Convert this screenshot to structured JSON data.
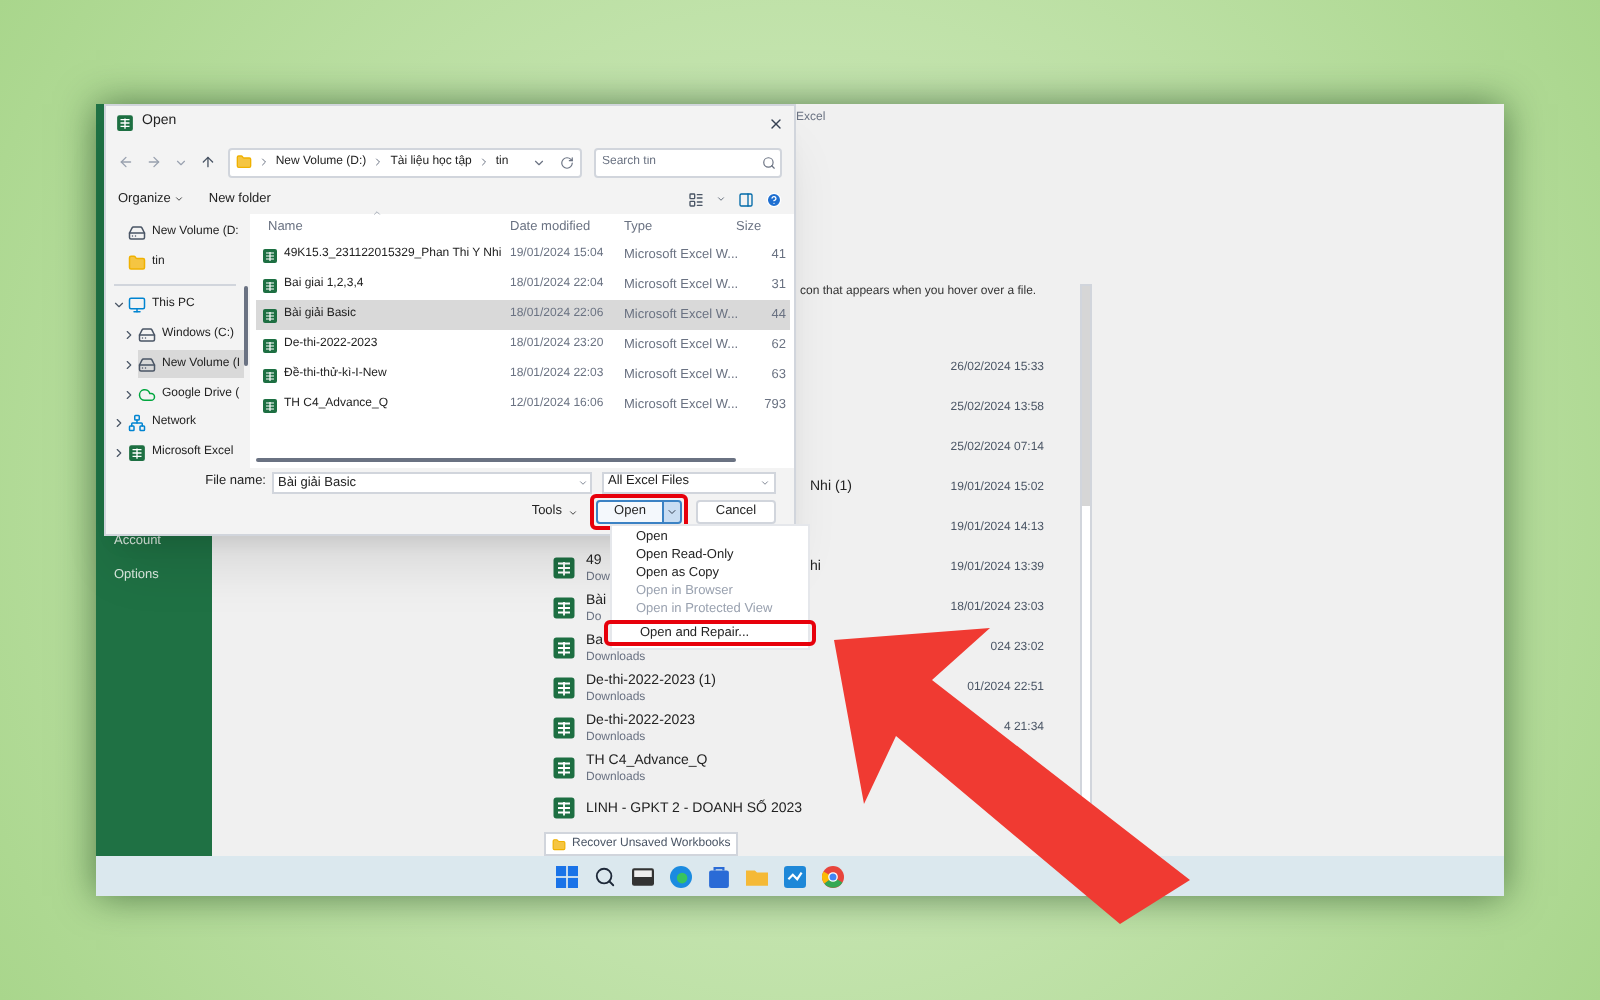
{
  "excel": {
    "title": "Excel",
    "sidebar": [
      "Account",
      "Options"
    ],
    "hint": "con that appears when you hover over a file.",
    "recent": [
      {
        "kind": "covered",
        "date": "26/02/2024 15:33"
      },
      {
        "kind": "covered",
        "date": "25/02/2024 13:58"
      },
      {
        "kind": "covered",
        "date": "25/02/2024 07:14"
      },
      {
        "kind": "covered",
        "tail": "Nhi (1)",
        "date": "19/01/2024 15:02"
      },
      {
        "kind": "covered",
        "date": "19/01/2024 14:13"
      },
      {
        "kind": "file",
        "name": "49",
        "location": "Dow",
        "tail": "hi",
        "date": "19/01/2024 13:39"
      },
      {
        "kind": "file",
        "name": "Bài",
        "location": "Do",
        "date": "18/01/2024 23:03"
      },
      {
        "kind": "file",
        "name": "Ba",
        "location": "Downloads",
        "date": "024 23:02"
      },
      {
        "kind": "file",
        "name": "De-thi-2022-2023 (1)",
        "location": "Downloads",
        "date": "01/2024 22:51"
      },
      {
        "kind": "file",
        "name": "De-thi-2022-2023",
        "location": "Downloads",
        "date": "4 21:34"
      },
      {
        "kind": "file",
        "name": "TH C4_Advance_Q",
        "location": "Downloads"
      },
      {
        "kind": "file",
        "name": "LINH - GPKT 2 - DOANH SỐ 2023"
      }
    ],
    "recover_button": "Recover Unsaved Workbooks"
  },
  "dialog": {
    "title": "Open",
    "path": [
      "New Volume (D:)",
      "Tài liệu học tập",
      "tin"
    ],
    "search": {
      "placeholder": "Search tin"
    },
    "toolbar": {
      "organize": "Organize",
      "new_folder": "New folder"
    },
    "nav": [
      {
        "label": "New Volume (D:",
        "kind": "drive",
        "selected": false
      },
      {
        "label": "tin",
        "kind": "folder",
        "selected": false
      },
      {
        "label": "This PC",
        "kind": "pc",
        "expanded": true,
        "selected": false,
        "children": [
          {
            "label": "Windows (C:)",
            "kind": "drive",
            "expanded": false,
            "selected": false
          },
          {
            "label": "New Volume (I",
            "kind": "drive",
            "expanded": false,
            "selected": true
          },
          {
            "label": "Google Drive (",
            "kind": "cloud",
            "expanded": false,
            "selected": false
          }
        ]
      },
      {
        "label": "Network",
        "kind": "network",
        "expanded": false,
        "selected": false
      },
      {
        "label": "Microsoft Excel",
        "kind": "excel",
        "expanded": false,
        "selected": false
      }
    ],
    "columns": [
      "Name",
      "Date modified",
      "Type",
      "Size"
    ],
    "files": [
      {
        "name": "49K15.3_231122015329_Phan Thi Y Nhi",
        "date": "19/01/2024 15:04",
        "type": "Microsoft Excel W...",
        "size": "41",
        "selected": false
      },
      {
        "name": "Bai giai 1,2,3,4",
        "date": "18/01/2024 22:04",
        "type": "Microsoft Excel W...",
        "size": "31",
        "selected": false
      },
      {
        "name": "Bài giải Basic",
        "date": "18/01/2024 22:06",
        "type": "Microsoft Excel W...",
        "size": "44",
        "selected": true
      },
      {
        "name": "De-thi-2022-2023",
        "date": "18/01/2024 23:20",
        "type": "Microsoft Excel W...",
        "size": "62",
        "selected": false
      },
      {
        "name": "Đề-thi-thử-kì-I-New",
        "date": "18/01/2024 22:03",
        "type": "Microsoft Excel W...",
        "size": "63",
        "selected": false
      },
      {
        "name": "TH C4_Advance_Q",
        "date": "12/01/2024 16:06",
        "type": "Microsoft Excel W...",
        "size": "793",
        "selected": false
      }
    ],
    "file_name": {
      "label": "File name:",
      "value": "Bài giải Basic"
    },
    "filter": "All Excel Files",
    "tools": "Tools",
    "open": "Open",
    "open_highlighted": true,
    "cancel": "Cancel"
  },
  "menu": [
    {
      "label": "Open",
      "disabled": false,
      "highlighted": false
    },
    {
      "label": "Open Read-Only",
      "disabled": false,
      "highlighted": false
    },
    {
      "label": "Open as Copy",
      "disabled": false,
      "highlighted": false
    },
    {
      "label": "Open in Browser",
      "disabled": true,
      "highlighted": false
    },
    {
      "label": "Open in Protected View",
      "disabled": true,
      "highlighted": false
    },
    {
      "label": "Open and Repair...",
      "disabled": false,
      "highlighted": true
    }
  ]
}
